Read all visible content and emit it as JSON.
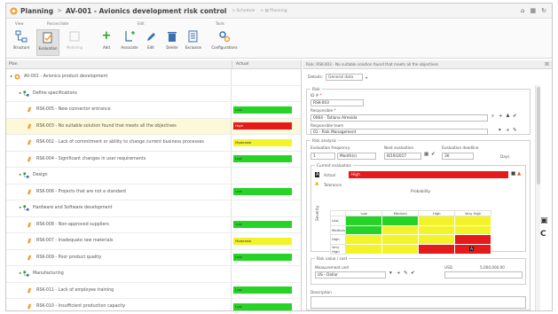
{
  "window": {
    "app": "Planning",
    "title": "AV-001 - Avionics development risk control",
    "crumb1": "Schedule",
    "crumb2": "Planning"
  },
  "ribbon": {
    "groups": [
      "View",
      "Reconciliate",
      "Edit",
      "Tools"
    ],
    "buttons": [
      {
        "label": "Structure",
        "icon": "structure-icon"
      },
      {
        "label": "Evaluation",
        "icon": "evaluation-icon",
        "active": true
      },
      {
        "label": "Modeling",
        "icon": "modeling-icon",
        "disabled": true
      },
      {
        "label": "Add",
        "icon": "add-icon"
      },
      {
        "label": "Associate",
        "icon": "associate-icon"
      },
      {
        "label": "Edit",
        "icon": "edit-icon"
      },
      {
        "label": "Delete",
        "icon": "delete-icon"
      },
      {
        "label": "Exclusion",
        "icon": "exclusion-icon"
      },
      {
        "label": "Configurations",
        "icon": "configurations-icon"
      }
    ]
  },
  "colors": {
    "green": "#27d327",
    "yellow": "#f3f32a",
    "red": "#e51a1a",
    "accent": "#f0a030"
  },
  "table": {
    "col_plan": "Plan",
    "col_actual": "Actual",
    "rows": [
      {
        "level": 0,
        "type": "root",
        "text": "AV-001 - Avionics product development",
        "status": "",
        "color": ""
      },
      {
        "level": 1,
        "type": "group",
        "text": "Define specifications",
        "status": "",
        "color": ""
      },
      {
        "level": 2,
        "type": "risk",
        "text": "RSK-005 - New connector entrance",
        "status": "Low",
        "color": "green"
      },
      {
        "level": 2,
        "type": "risk",
        "text": "RSK-003 - No suitable solution found that meets all the objectives",
        "status": "High",
        "color": "red",
        "selected": true
      },
      {
        "level": 2,
        "type": "risk",
        "text": "RSK-002 - Lack of commitment or ability to change current business processes",
        "status": "Moderate",
        "color": "yellow"
      },
      {
        "level": 2,
        "type": "risk",
        "text": "RSK-004 - Significant changes in user requirements",
        "status": "Low",
        "color": "green"
      },
      {
        "level": 1,
        "type": "group",
        "text": "Design",
        "status": "",
        "color": ""
      },
      {
        "level": 2,
        "type": "risk",
        "text": "RSK-006 - Projects that are not a standard",
        "status": "Low",
        "color": "green"
      },
      {
        "level": 1,
        "type": "group",
        "text": "Hardware and Software development",
        "status": "",
        "color": ""
      },
      {
        "level": 2,
        "type": "risk",
        "text": "RSK-008 - Non-approved suppliers",
        "status": "Low",
        "color": "green"
      },
      {
        "level": 2,
        "type": "risk",
        "text": "RSK-007 - Inadequate raw materials",
        "status": "Moderate",
        "color": "yellow"
      },
      {
        "level": 2,
        "type": "risk",
        "text": "RSK-009 - Poor product quality",
        "status": "Low",
        "color": "green"
      },
      {
        "level": 1,
        "type": "group",
        "text": "Manufacturing",
        "status": "",
        "color": ""
      },
      {
        "level": 2,
        "type": "risk",
        "text": "RSK-011 - Lack of employee training",
        "status": "Low",
        "color": "green"
      },
      {
        "level": 2,
        "type": "risk",
        "text": "RSK-010 - Insufficient production capacity",
        "status": "Low",
        "color": "green"
      }
    ]
  },
  "panel": {
    "header": "Risk: RSK-003 - No suitable solution found that meets all the objectives",
    "details_label": "Details:",
    "details_value": "General data",
    "risk_legend": "Risk",
    "id_label": "ID #",
    "id_value": "RSK-003",
    "responsible_label": "Responsible",
    "responsible_value": "0064 - Tatiana Almeida",
    "team_label": "Responsible team",
    "team_value": "01 - Risk Management",
    "analysis_legend": "Risk analysis",
    "freq_label": "Evaluation frequency",
    "freq_value": "1",
    "freq_unit": "Month(s)",
    "next_label": "Next evaluation",
    "next_value": "8/19/2017",
    "deadline_label": "Evaluation deadline",
    "deadline_value": "30",
    "deadline_unit": "Days",
    "current_legend": "Current evaluation",
    "actual_label": "Actual",
    "actual_value": "High",
    "tolerance_label": "Tolerance",
    "matrix_title": "Probability",
    "matrix_axis": "Severity",
    "matrix_cols": [
      "Low",
      "Medium",
      "High",
      "Very High"
    ],
    "matrix_rows": [
      {
        "label": "Low",
        "cells": [
          "green",
          "green",
          "yellow",
          "yellow"
        ]
      },
      {
        "label": "Medium",
        "cells": [
          "green",
          "yellow",
          "yellow",
          "yellow"
        ]
      },
      {
        "label": "High",
        "cells": [
          "yellow",
          "yellow",
          "yellow",
          "red"
        ]
      },
      {
        "label": "Very High",
        "cells": [
          "yellow",
          "yellow",
          "red",
          "red"
        ]
      }
    ],
    "values_legend": "Risk value / cost",
    "measure_label": "Measurement unit",
    "measure_value": "US - Dollar",
    "cost_label": "USD",
    "cost_value": "5,000,000.00",
    "description_label": "Description"
  }
}
